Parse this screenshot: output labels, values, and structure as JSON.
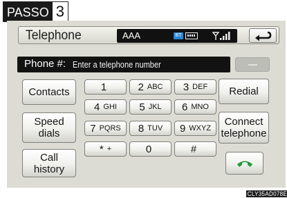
{
  "step": {
    "label": "PASSO",
    "number": "3"
  },
  "header": {
    "title": "Telephone",
    "device_name": "AAA",
    "bt_badge": "BT"
  },
  "number_field": {
    "label": "Phone #:",
    "placeholder": "Enter a telephone number"
  },
  "left_buttons": {
    "contacts": "Contacts",
    "speed_dials_1": "Speed",
    "speed_dials_2": "dials",
    "call_history_1": "Call",
    "call_history_2": "history"
  },
  "right_buttons": {
    "redial": "Redial",
    "connect_1": "Connect",
    "connect_2": "telephone"
  },
  "keypad": [
    {
      "digit": "1",
      "letters": ""
    },
    {
      "digit": "2",
      "letters": "ABC"
    },
    {
      "digit": "3",
      "letters": "DEF"
    },
    {
      "digit": "4",
      "letters": "GHI"
    },
    {
      "digit": "5",
      "letters": "JKL"
    },
    {
      "digit": "6",
      "letters": "MNO"
    },
    {
      "digit": "7",
      "letters": "PQRS"
    },
    {
      "digit": "8",
      "letters": "TUV"
    },
    {
      "digit": "9",
      "letters": "WXYZ"
    },
    {
      "digit": "*",
      "letters": "+"
    },
    {
      "digit": "0",
      "letters": ""
    },
    {
      "digit": "#",
      "letters": ""
    }
  ],
  "colors": {
    "call_green": "#1f9a3a",
    "bt_blue": "#2a86d8"
  },
  "figure_code": "CLY35AD078E"
}
